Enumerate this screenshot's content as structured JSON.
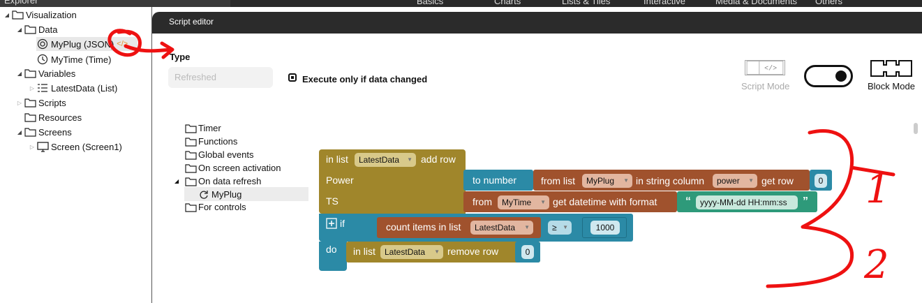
{
  "explorer": {
    "title": "Explorer",
    "tree": [
      {
        "label": "Visualization",
        "icon": "folder-icon"
      },
      {
        "label": "Data",
        "icon": "folder-icon"
      },
      {
        "label": "MyPlug (JSON)",
        "icon": "plug-icon"
      },
      {
        "label": "MyTime (Time)",
        "icon": "clock-icon"
      },
      {
        "label": "Variables",
        "icon": "folder-icon"
      },
      {
        "label": "LatestData (List)",
        "icon": "list-icon"
      },
      {
        "label": "Scripts",
        "icon": "folder-icon"
      },
      {
        "label": "Resources",
        "icon": "folder-icon"
      },
      {
        "label": "Screens",
        "icon": "folder-icon"
      },
      {
        "label": "Screen (Screen1)",
        "icon": "monitor-icon"
      }
    ]
  },
  "topnav": [
    "Basics",
    "Charts",
    "Lists & Tiles",
    "Interactive",
    "Media & Documents",
    "Others"
  ],
  "editor": {
    "title": "Script editor",
    "type_label": "Type",
    "type_value": "Refreshed",
    "execute_label": "Execute only if data changed",
    "script_mode_label": "Script Mode",
    "block_mode_label": "Block Mode"
  },
  "categories": [
    "Timer",
    "Functions",
    "Global events",
    "On screen activation",
    "On data refresh",
    "MyPlug",
    "For controls"
  ],
  "blocks": {
    "in_list": "in list",
    "latestdata": "LatestData",
    "add_row": "add row",
    "power": "Power",
    "ts": "TS",
    "to_number": "to number",
    "from_list": "from list",
    "myplug": "MyPlug",
    "in_string_column": "in string column",
    "power_col": "power",
    "get_row": "get row",
    "zero": "0",
    "from": "from",
    "mytime": "MyTime",
    "get_datetime": "get datetime with format",
    "format": "yyyy-MM-dd HH:mm:ss",
    "if": "if",
    "count_items": "count items in list",
    "gte": "≥",
    "thousand": "1000",
    "do": "do",
    "remove_row": "remove row"
  },
  "annotations": {
    "one": "1",
    "two": "2"
  },
  "colors": {
    "list_block": "#a0862b",
    "math_block": "#2b8aa6",
    "text_block": "#a0522d",
    "string_block": "#2e9a7a",
    "logic_block": "#2b8aa6"
  }
}
